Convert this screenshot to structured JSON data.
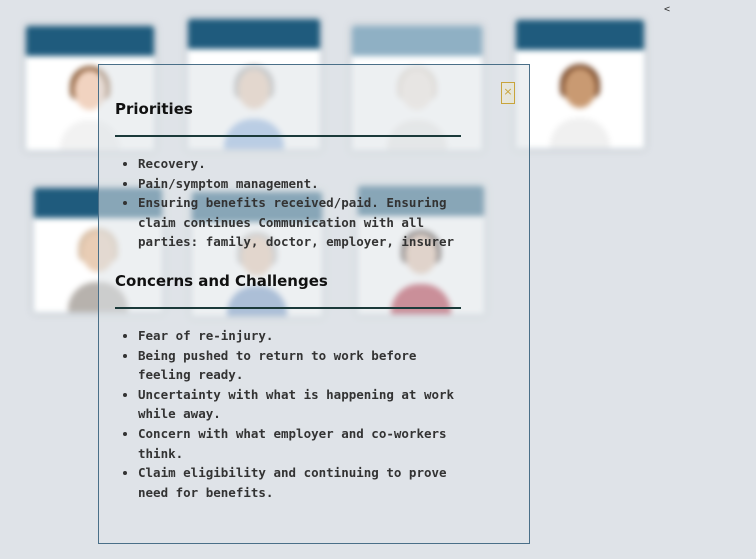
{
  "background": {
    "back_arrow": "<",
    "cards": [
      {
        "header": "",
        "header_style": "dark"
      },
      {
        "header": "",
        "header_style": "dark"
      },
      {
        "header": "",
        "header_style": "pale"
      },
      {
        "header": "",
        "header_style": "dark"
      },
      {
        "header": "",
        "header_style": "dark"
      },
      {
        "header": "",
        "header_style": "dark"
      },
      {
        "header": "",
        "header_style": "dark"
      }
    ]
  },
  "modal": {
    "close_icon": "close-icon",
    "close_label": "×",
    "sections": [
      {
        "title": "Priorities",
        "items": [
          "Recovery.",
          "Pain/symptom management.",
          "Ensuring benefits received/paid. Ensuring claim continues Communication with all parties: family, doctor, employer, insurer"
        ]
      },
      {
        "title": "Concerns and Challenges",
        "items": [
          "Fear of re-injury.",
          "Being pushed to return to work before feeling ready.",
          "Uncertainty with what is happening at work while away.",
          "Concern with what employer and co-workers think.",
          "Claim eligibility and continuing to prove need for benefits."
        ]
      }
    ]
  },
  "colors": {
    "card_header": "#1f5b7d",
    "card_header_pale": "#8fb0c4",
    "modal_border": "#4a6f88",
    "close_accent": "#c8a43b",
    "page_bg": "#dfe3e8"
  }
}
